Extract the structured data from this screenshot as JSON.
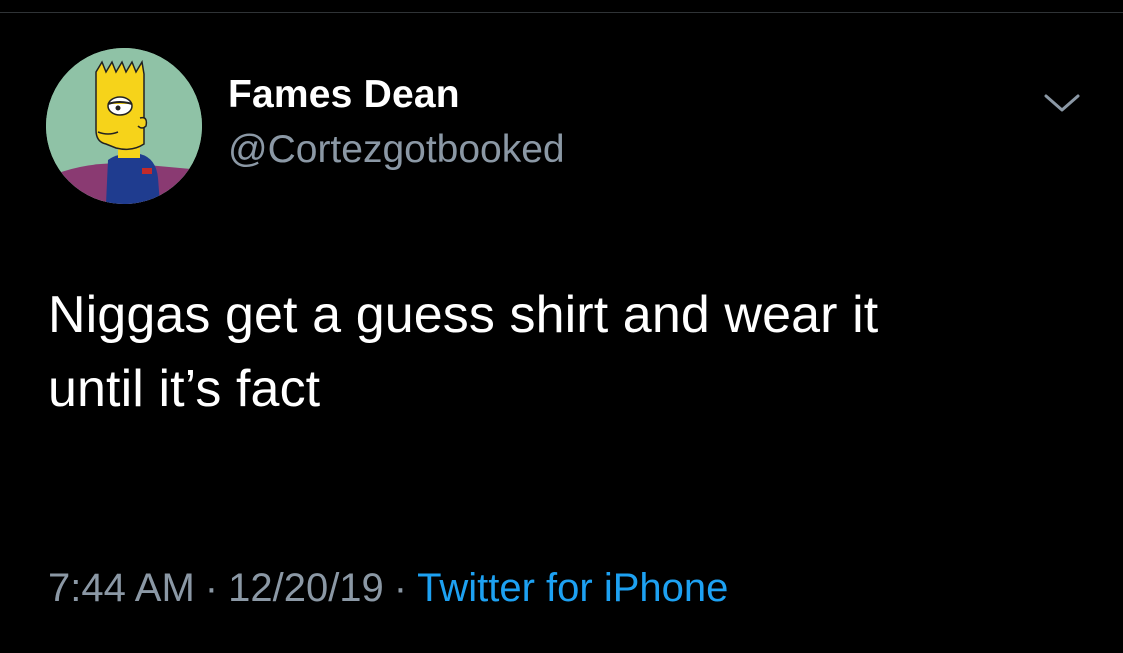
{
  "tweet": {
    "author": {
      "display_name": "Fames Dean",
      "handle": "@Cortezgotbooked"
    },
    "text_line1": "Niggas get a guess shirt and wear it",
    "text_line2": "until it’s fact",
    "time": "7:44 AM",
    "date": "12/20/19",
    "separator": "·",
    "source": "Twitter for iPhone"
  },
  "icons": {
    "more": "chevron-down-icon"
  },
  "colors": {
    "background": "#000000",
    "primary_text": "#ffffff",
    "secondary_text": "#8b98a5",
    "link": "#1da1f2"
  }
}
